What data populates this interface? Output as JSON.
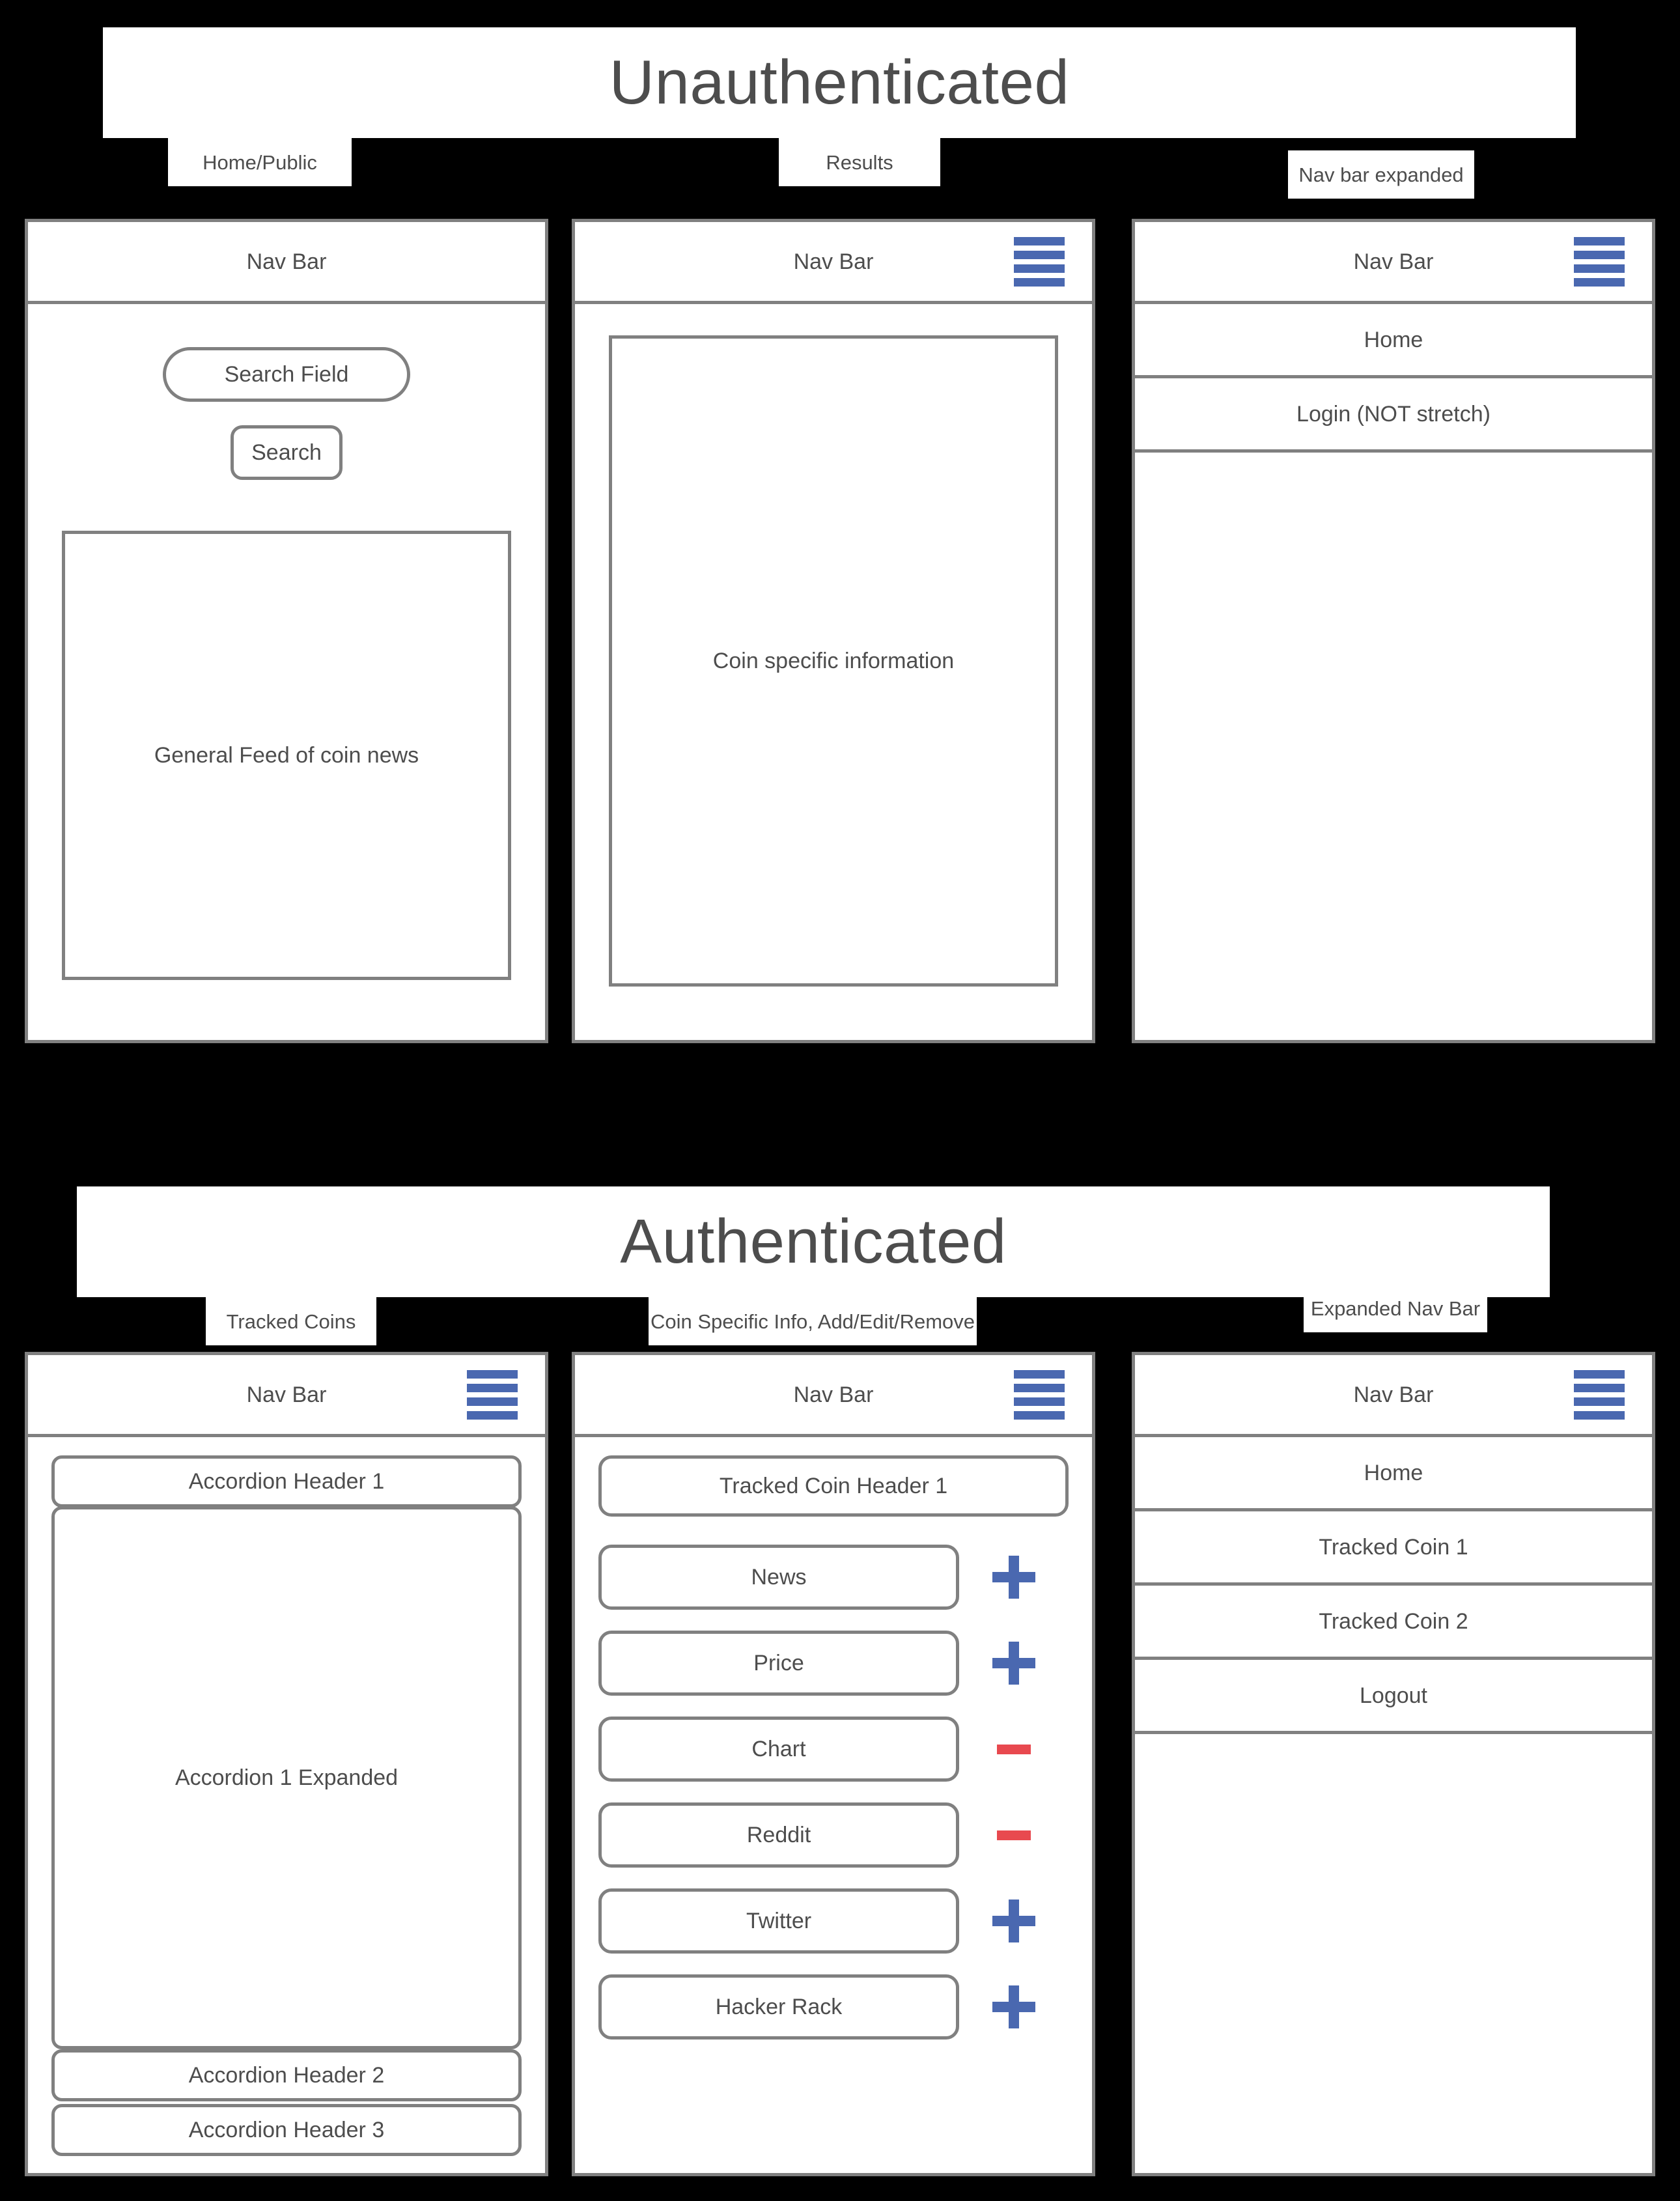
{
  "sections": {
    "unauthenticated": {
      "banner_title": "Unauthenticated",
      "captions": {
        "home": "Home/Public",
        "results": "Results",
        "nav_expanded": "Nav bar expanded"
      }
    },
    "authenticated": {
      "banner_title": "Authenticated",
      "captions": {
        "tracked_coins": "Tracked Coins",
        "coin_specific": "Coin Specific Info, Add/Edit/Remove",
        "expanded_nav": "Expanded Nav Bar"
      }
    }
  },
  "common": {
    "nav_bar_title": "Nav Bar",
    "hamburger_icon": "hamburger-menu-icon"
  },
  "panel_home": {
    "navbar_title": "Nav Bar",
    "search_field_placeholder": "Search Field",
    "search_button_label": "Search",
    "feed_label": "General Feed of coin news"
  },
  "panel_results": {
    "navbar_title": "Nav Bar",
    "coin_info_label": "Coin specific information"
  },
  "panel_nav_expanded": {
    "navbar_title": "Nav Bar",
    "items": [
      {
        "label": "Home"
      },
      {
        "label": "Login (NOT stretch)"
      }
    ]
  },
  "panel_tracked_coins": {
    "navbar_title": "Nav Bar",
    "accordion_header_1": "Accordion Header 1",
    "accordion_expanded_label": "Accordion 1 Expanded",
    "accordion_header_2": "Accordion Header 2",
    "accordion_header_3": "Accordion Header 3"
  },
  "panel_coin_specific": {
    "navbar_title": "Nav Bar",
    "tracked_coin_header": "Tracked Coin Header 1",
    "rows": [
      {
        "label": "News",
        "action": "add",
        "action_icon": "plus-icon"
      },
      {
        "label": "Price",
        "action": "add",
        "action_icon": "plus-icon"
      },
      {
        "label": "Chart",
        "action": "remove",
        "action_icon": "minus-icon"
      },
      {
        "label": "Reddit",
        "action": "remove",
        "action_icon": "minus-icon"
      },
      {
        "label": "Twitter",
        "action": "add",
        "action_icon": "plus-icon"
      },
      {
        "label": "Hacker Rack",
        "action": "add",
        "action_icon": "plus-icon"
      }
    ]
  },
  "panel_expanded_nav": {
    "navbar_title": "Nav Bar",
    "items": [
      {
        "label": "Home"
      },
      {
        "label": "Tracked Coin 1"
      },
      {
        "label": "Tracked Coin 2"
      },
      {
        "label": "Logout"
      }
    ]
  },
  "colors": {
    "background": "#000000",
    "panel_background": "#ffffff",
    "border": "#808080",
    "text": "#4d4d4d",
    "accent_blue": "#4a68b0",
    "accent_red": "#e8494f"
  }
}
